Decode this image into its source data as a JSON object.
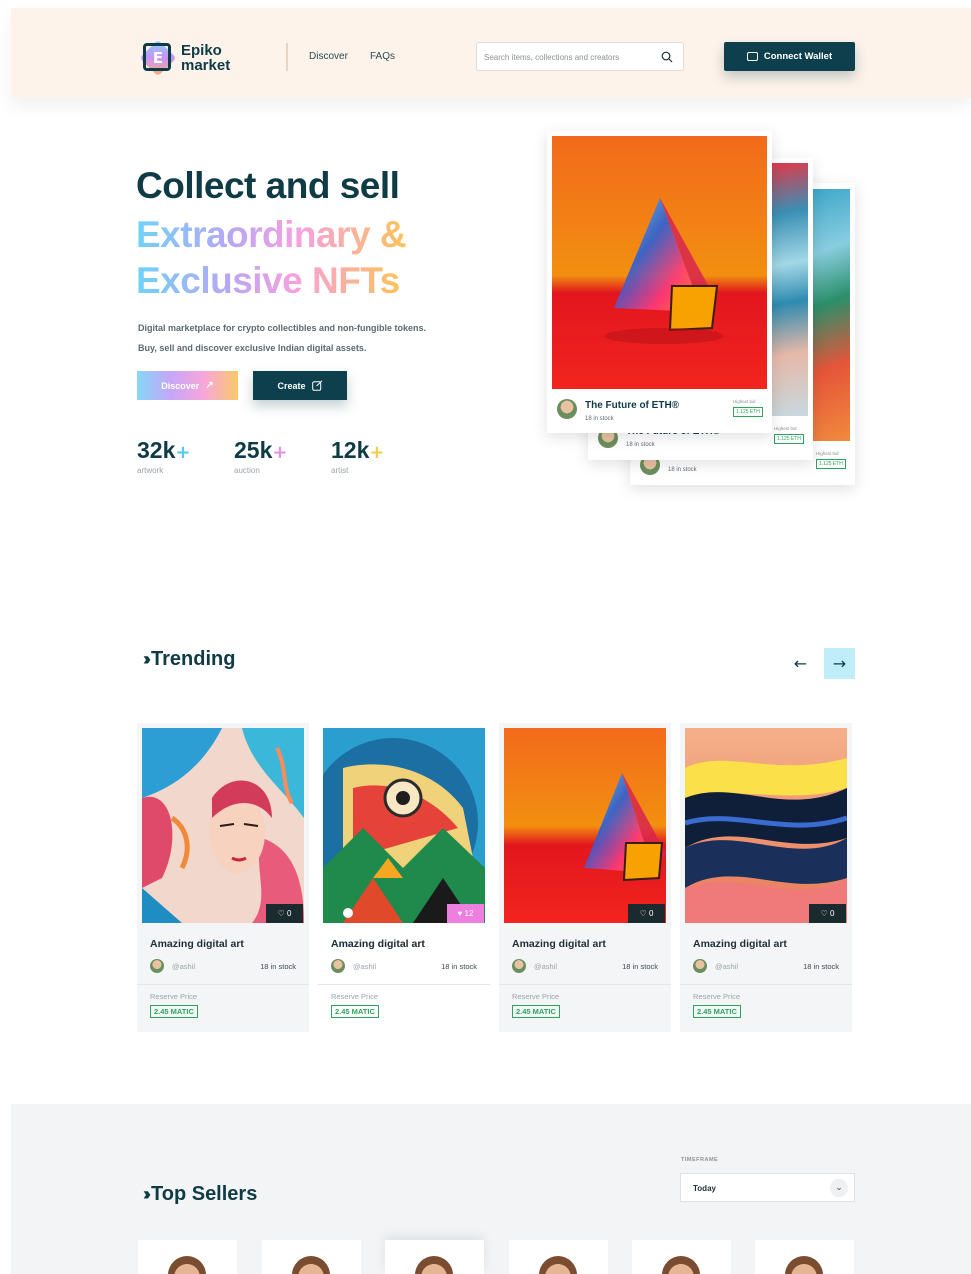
{
  "header": {
    "logo_letter": "E",
    "logo_line1": "Epiko",
    "logo_line2": "market",
    "nav": [
      "Discover",
      "FAQs"
    ],
    "search_placeholder": "Search items, collections and creators",
    "connect_label": "Connect Wallet"
  },
  "hero": {
    "line1": "Collect and sell",
    "line2": "Extraordinary &",
    "line3": "Exclusive NFTs",
    "desc1": "Digital marketplace for crypto collectibles and non-fungible tokens.",
    "desc2": "Buy, sell and discover exclusive Indian digital assets.",
    "discover_label": "Discover",
    "create_label": "Create",
    "stats": [
      {
        "value": "32k",
        "plus": "+",
        "label": "artwork",
        "plus_color": "#4fc9f0"
      },
      {
        "value": "25k",
        "plus": "+",
        "label": "auction",
        "plus_color": "#e98ce6"
      },
      {
        "value": "12k",
        "plus": "+",
        "label": "artist",
        "plus_color": "#f7c84a"
      }
    ]
  },
  "hero_cards": [
    {
      "title": "The Future of ETH®",
      "stock": "18 in stock",
      "bid_label": "Highest bid",
      "bid": "1.125 ETH"
    },
    {
      "title": "The Future of ETH®",
      "stock": "18 in stock",
      "bid_label": "Highest bid",
      "bid": "1.125 ETH"
    },
    {
      "title": "The Future of ETH®",
      "stock": "18 in stock",
      "bid_label": "Highest bid",
      "bid": "1.125 ETH"
    }
  ],
  "trending": {
    "title": "Trending",
    "cards": [
      {
        "name": "Amazing digital art",
        "handle": "@ashil",
        "stock": "18 in stock",
        "likes": "0",
        "reserve_label": "Reserve Price",
        "price": "2.45 MATIC"
      },
      {
        "name": "Amazing digital art",
        "handle": "@ashil",
        "stock": "18 in stock",
        "likes": "12",
        "reserve_label": "Reserve Price",
        "price": "2.45 MATIC"
      },
      {
        "name": "Amazing digital art",
        "handle": "@ashil",
        "stock": "18 in stock",
        "likes": "0",
        "reserve_label": "Reserve Price",
        "price": "2.45 MATIC"
      },
      {
        "name": "Amazing digital art",
        "handle": "@ashil",
        "stock": "18 in stock",
        "likes": "0",
        "reserve_label": "Reserve Price",
        "price": "2.45 MATIC"
      }
    ]
  },
  "top_sellers": {
    "title": "Top Sellers",
    "timeframe_label": "TIMEFRAME",
    "timeframe_value": "Today"
  }
}
